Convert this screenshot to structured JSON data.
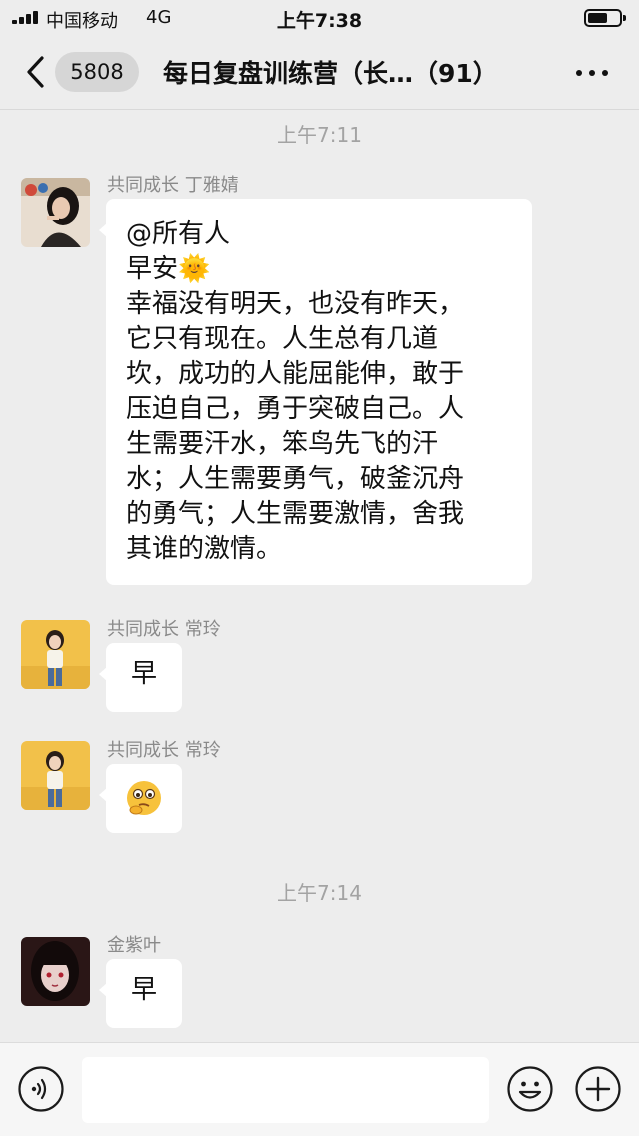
{
  "status_bar": {
    "carrier": "中国移动",
    "network": "4G",
    "time": "上午7:38"
  },
  "nav": {
    "unread_count": "5808",
    "title": "每日复盘训练营（长…（91）"
  },
  "timestamps": [
    "上午7:11",
    "上午7:14"
  ],
  "messages": [
    {
      "sender": "共同成长 丁雅婧",
      "text": "@所有人\n早安",
      "emoji": "🌞",
      "text2": "幸福没有明天，也没有昨天，\n它只有现在。人生总有几道\n坎，成功的人能屈能伸，敢于\n压迫自己，勇于突破自己。人\n生需要汗水，笨鸟先飞的汗\n水；人生需要勇气，破釜沉舟\n的勇气；人生需要激情，舍我\n其谁的激情。"
    },
    {
      "sender": "共同成长 常玲",
      "text": "早"
    },
    {
      "sender": "共同成长 常玲",
      "emoji_name": "thinking-face-emoji"
    },
    {
      "sender": "金紫叶",
      "text": "早"
    }
  ],
  "input": {
    "placeholder": "",
    "value": ""
  },
  "colors": {
    "background": "#ededed",
    "bubble": "#ffffff",
    "meta_text": "#a3a3a3"
  }
}
